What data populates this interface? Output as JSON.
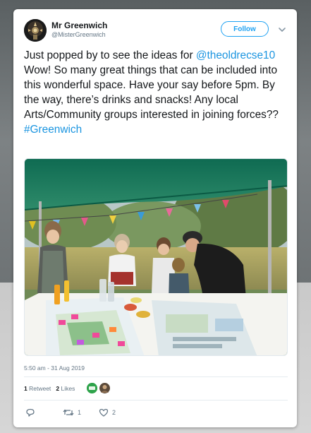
{
  "user": {
    "name": "Mr Greenwich",
    "handle": "@MisterGreenwich"
  },
  "follow_label": "Follow",
  "tweet": {
    "text_1": "Just popped by to see the ideas for ",
    "mention": "@theoldrecse10",
    "text_2": " Wow! So many great things that can be included into this wonderful space. Have your say before 5pm. By the way, there’s drinks and snacks! Any local Arts/Community groups interested in joining forces?? ",
    "hashtag": "#Greenwich"
  },
  "timestamp": "5:50 am - 31 Aug 2019",
  "stats": {
    "retweets_count": "1",
    "retweets_label": "Retweet",
    "likes_count": "2",
    "likes_label": "Likes"
  },
  "actions": {
    "reply_icon": "reply-icon",
    "retweet_icon": "retweet-icon",
    "retweet_count": "1",
    "like_icon": "heart-icon",
    "like_count": "2"
  },
  "colors": {
    "accent": "#1da1f2",
    "link": "#1b95e0",
    "text": "#14171a",
    "muted": "#657786"
  }
}
